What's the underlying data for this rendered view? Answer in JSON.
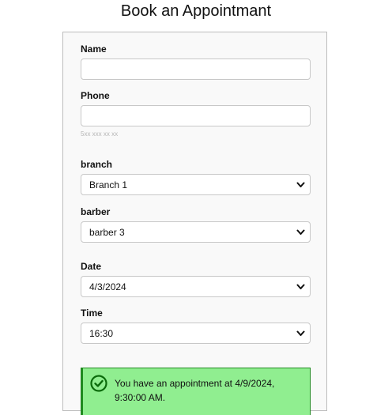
{
  "page": {
    "title": "Book an Appointmant"
  },
  "form": {
    "name": {
      "label": "Name",
      "value": "",
      "placeholder": ""
    },
    "phone": {
      "label": "Phone",
      "value": "",
      "placeholder": "",
      "hint": "5xx xxx xx xx"
    },
    "branch": {
      "label": "branch",
      "selected": "Branch 1"
    },
    "barber": {
      "label": "barber",
      "selected": "barber 3"
    },
    "date": {
      "label": "Date",
      "selected": "4/3/2024"
    },
    "time": {
      "label": "Time",
      "selected": "16:30"
    }
  },
  "alert": {
    "message": "You have an appointment at 4/9/2024, 9:30:00 AM.",
    "icon": "check-circle-icon",
    "background_color": "#90ee90",
    "accent_color": "#1f8a1f"
  }
}
